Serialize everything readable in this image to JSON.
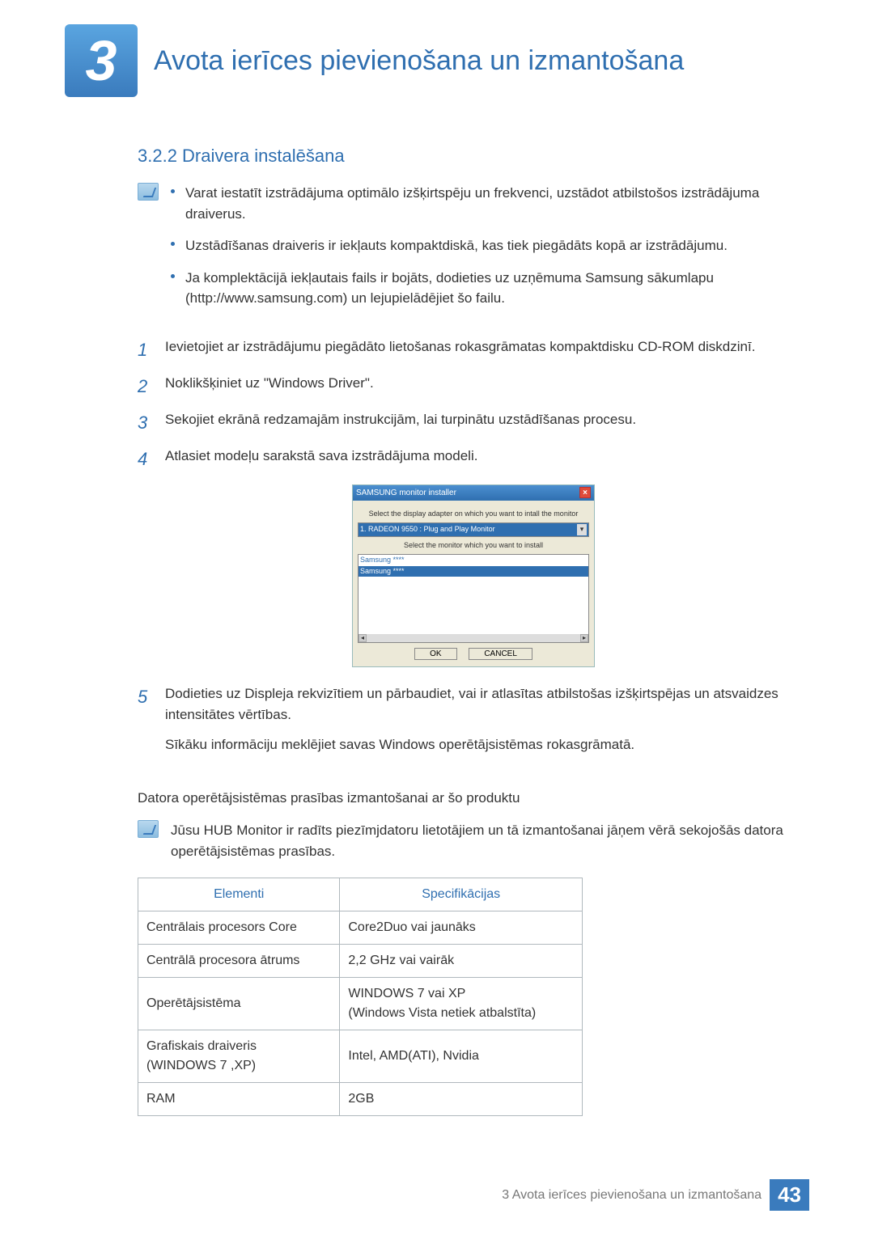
{
  "chapter": {
    "num": "3",
    "title": "Avota ierīces pievienošana un izmantošana"
  },
  "section": {
    "num_title": "3.2.2 Draivera instalēšana"
  },
  "note1": {
    "items": [
      "Varat iestatīt izstrādājuma optimālo izšķirtspēju un frekvenci, uzstādot atbilstošos izstrādājuma draiverus.",
      "Uzstādīšanas draiveris ir iekļauts kompaktdiskā, kas tiek piegādāts kopā ar izstrādājumu.",
      "Ja komplektācijā iekļautais fails ir bojāts, dodieties uz uzņēmuma Samsung sākumlapu (http://www.samsung.com) un lejupielādējiet šo failu."
    ]
  },
  "steps": [
    {
      "n": "1",
      "t": "Ievietojiet ar izstrādājumu piegādāto lietošanas rokasgrāmatas kompaktdisku CD-ROM diskdzinī."
    },
    {
      "n": "2",
      "t": "Noklikšķiniet uz \"Windows Driver\"."
    },
    {
      "n": "3",
      "t": "Sekojiet ekrānā redzamajām instrukcijām, lai turpinātu uzstādīšanas procesu."
    },
    {
      "n": "4",
      "t": "Atlasiet modeļu sarakstā sava izstrādājuma modeli."
    }
  ],
  "installer": {
    "title": "SAMSUNG monitor installer",
    "label1": "Select the display adapter on which you want to intall the monitor",
    "combo": "1. RADEON 9550 : Plug and Play Monitor",
    "label2": "Select the monitor which you want to install",
    "rows": [
      "Samsung ****",
      "Samsung ****"
    ],
    "ok": "OK",
    "cancel": "CANCEL"
  },
  "step5": {
    "n": "5",
    "t": "Dodieties uz Displeja rekvizītiem un pārbaudiet, vai ir atlasītas atbilstošas izšķirtspējas un atsvaidzes intensitātes vērtības."
  },
  "step5_extra": "Sīkāku informāciju meklējiet savas Windows operētājsistēmas rokasgrāmatā.",
  "sys_title": "Datora operētājsistēmas prasības izmantošanai ar šo produktu",
  "note2": "Jūsu HUB Monitor ir radīts piezīmjdatoru lietotājiem un tā izmantošanai jāņem vērā sekojošās datora operētājsistēmas prasības.",
  "table": {
    "h1": "Elementi",
    "h2": "Specifikācijas",
    "rows": [
      [
        "Centrālais procesors Core",
        "Core2Duo vai jaunāks"
      ],
      [
        "Centrālā procesora ātrums",
        "2,2 GHz vai vairāk"
      ],
      [
        "Operētājsistēma",
        "WINDOWS 7 vai XP\n(Windows Vista netiek atbalstīta)"
      ],
      [
        "Grafiskais draiveris\n(WINDOWS 7 ,XP)",
        "Intel, AMD(ATI), Nvidia"
      ],
      [
        "RAM",
        "2GB"
      ]
    ]
  },
  "footer": {
    "text": "3 Avota ierīces pievienošana un izmantošana",
    "page": "43"
  }
}
